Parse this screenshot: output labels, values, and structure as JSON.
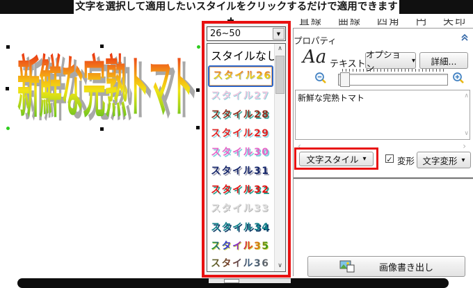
{
  "banner": {
    "top_text": "文字を選択して適用したいスタイルをクリックするだけで適用できます"
  },
  "canvas": {
    "artwork_text": "新鮮な完熟トマト",
    "gradient_colors": [
      "#e8280e",
      "#f5ba12",
      "#46b822"
    ],
    "handle_colors": {
      "corner": "#0a0a0a",
      "rotate": "#2ecc1e"
    }
  },
  "toolbar": {
    "fragments": [
      "直線",
      "曲線",
      "四角",
      "円",
      "矢印"
    ]
  },
  "style_panel": {
    "range_selector": {
      "value": "26~50"
    },
    "highlight_color": "#e81111",
    "selection_border_color": "#2a64c8",
    "items": [
      {
        "label": "スタイルなし",
        "selected": false
      },
      {
        "label": "スタイル26",
        "selected": true
      },
      {
        "label": "スタイル27",
        "selected": false
      },
      {
        "label": "スタイル28",
        "selected": false
      },
      {
        "label": "スタイル29",
        "selected": false
      },
      {
        "label": "スタイル30",
        "selected": false
      },
      {
        "label": "スタイル31",
        "selected": false
      },
      {
        "label": "スタイル32",
        "selected": false
      },
      {
        "label": "スタイル33",
        "selected": false
      },
      {
        "label": "スタイル34",
        "selected": false
      },
      {
        "label": "スタイル35",
        "selected": false
      },
      {
        "label": "スタイル36",
        "selected": false,
        "partially_visible": true
      }
    ]
  },
  "properties": {
    "title": "プロパティ",
    "collapse_icon": "double-chevron-up",
    "aa_glyph": "Aa",
    "text_label": "テキスト",
    "options_button": "オプション",
    "details_button": "詳細...",
    "zoom_out_icon": "magnifier-minus",
    "zoom_in_icon": "magnifier-plus",
    "text_content": "新鮮な完熟トマト",
    "char_style_button": "文字スタイル",
    "transform_checkbox": {
      "label": "変形",
      "checked": true
    },
    "char_transform_button": "文字変形",
    "export_button": "画像書き出し",
    "export_icon": "image-export"
  }
}
